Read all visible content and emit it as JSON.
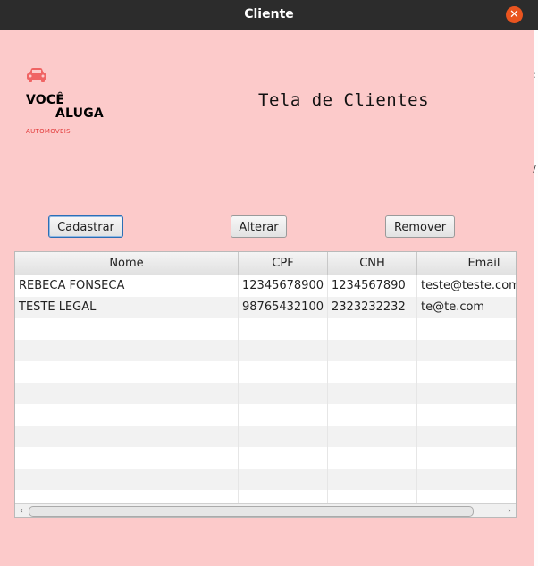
{
  "window": {
    "title": "Cliente"
  },
  "logo": {
    "line1": "VOCÊ",
    "line2": "ALUGA",
    "line3": "AUTOMOVEIS",
    "accent": "#f06464"
  },
  "page": {
    "title": "Tela de Clientes"
  },
  "buttons": {
    "cadastrar": "Cadastrar",
    "alterar": "Alterar",
    "remover": "Remover"
  },
  "table": {
    "headers": [
      "Nome",
      "CPF",
      "CNH",
      "Email"
    ],
    "rows": [
      [
        "REBECA FONSECA",
        "12345678900",
        "1234567890",
        "teste@teste.com"
      ],
      [
        "TESTE LEGAL",
        "98765432100",
        "2323232232",
        "te@te.com"
      ]
    ]
  },
  "edge": {
    "c1": ":",
    "c2": "/"
  },
  "colors": {
    "background": "#fccaca",
    "titlebar": "#2c2c2c",
    "close": "#e9541f"
  }
}
